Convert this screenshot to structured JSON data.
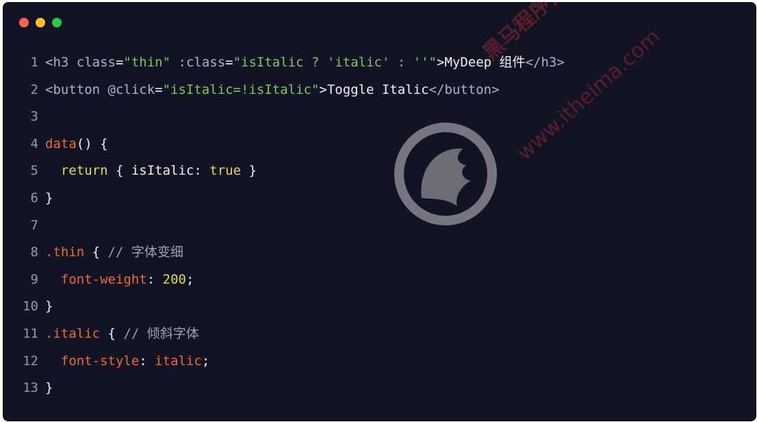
{
  "window": {
    "colors": {
      "background": "#121324",
      "close": "#ff5f57",
      "minimize": "#febc2e",
      "maximize": "#28c840"
    }
  },
  "watermark": {
    "brand": "黑马程序员",
    "url": "www.itheima.com"
  },
  "code": {
    "lines": [
      {
        "number": "1",
        "tokens": [
          {
            "text": "<h3 ",
            "class": "t-tag"
          },
          {
            "text": "class",
            "class": "t-attr"
          },
          {
            "text": "=",
            "class": "t-plain"
          },
          {
            "text": "\"thin\"",
            "class": "t-str"
          },
          {
            "text": " ",
            "class": "t-plain"
          },
          {
            "text": ":class",
            "class": "t-attr"
          },
          {
            "text": "=",
            "class": "t-plain"
          },
          {
            "text": "\"isItalic ? 'italic' : ''\"",
            "class": "t-str"
          },
          {
            "text": ">",
            "class": "t-plain"
          },
          {
            "text": "MyDeep 组件",
            "class": "t-plain"
          },
          {
            "text": "</h3>",
            "class": "t-tag"
          }
        ]
      },
      {
        "number": "2",
        "tokens": [
          {
            "text": "<button ",
            "class": "t-tag"
          },
          {
            "text": "@click",
            "class": "t-attr"
          },
          {
            "text": "=",
            "class": "t-plain"
          },
          {
            "text": "\"isItalic=!isItalic\"",
            "class": "t-str"
          },
          {
            "text": ">",
            "class": "t-plain"
          },
          {
            "text": "Toggle Italic",
            "class": "t-plain"
          },
          {
            "text": "</button>",
            "class": "t-tag"
          }
        ]
      },
      {
        "number": "3",
        "tokens": []
      },
      {
        "number": "4",
        "tokens": [
          {
            "text": "data",
            "class": "t-fn"
          },
          {
            "text": "() {",
            "class": "t-plain"
          }
        ]
      },
      {
        "number": "5",
        "tokens": [
          {
            "text": "  ",
            "class": "t-plain"
          },
          {
            "text": "return",
            "class": "t-kw"
          },
          {
            "text": " { isItalic: ",
            "class": "t-plain"
          },
          {
            "text": "true",
            "class": "t-kw"
          },
          {
            "text": " }",
            "class": "t-plain"
          }
        ]
      },
      {
        "number": "6",
        "tokens": [
          {
            "text": "}",
            "class": "t-plain"
          }
        ]
      },
      {
        "number": "7",
        "tokens": []
      },
      {
        "number": "8",
        "tokens": [
          {
            "text": ".thin",
            "class": "t-sel"
          },
          {
            "text": " { ",
            "class": "t-plain"
          },
          {
            "text": "// 字体变细",
            "class": "t-com"
          }
        ]
      },
      {
        "number": "9",
        "tokens": [
          {
            "text": "  ",
            "class": "t-plain"
          },
          {
            "text": "font-weight",
            "class": "t-prop"
          },
          {
            "text": ": ",
            "class": "t-plain"
          },
          {
            "text": "200",
            "class": "t-num"
          },
          {
            "text": ";",
            "class": "t-plain"
          }
        ]
      },
      {
        "number": "10",
        "tokens": [
          {
            "text": "}",
            "class": "t-plain"
          }
        ]
      },
      {
        "number": "11",
        "tokens": [
          {
            "text": ".italic",
            "class": "t-sel"
          },
          {
            "text": " { ",
            "class": "t-plain"
          },
          {
            "text": "// 倾斜字体",
            "class": "t-com"
          }
        ]
      },
      {
        "number": "12",
        "tokens": [
          {
            "text": "  ",
            "class": "t-plain"
          },
          {
            "text": "font-style",
            "class": "t-prop"
          },
          {
            "text": ": ",
            "class": "t-plain"
          },
          {
            "text": "italic",
            "class": "t-val"
          },
          {
            "text": ";",
            "class": "t-plain"
          }
        ]
      },
      {
        "number": "13",
        "tokens": [
          {
            "text": "}",
            "class": "t-plain"
          }
        ]
      }
    ]
  }
}
